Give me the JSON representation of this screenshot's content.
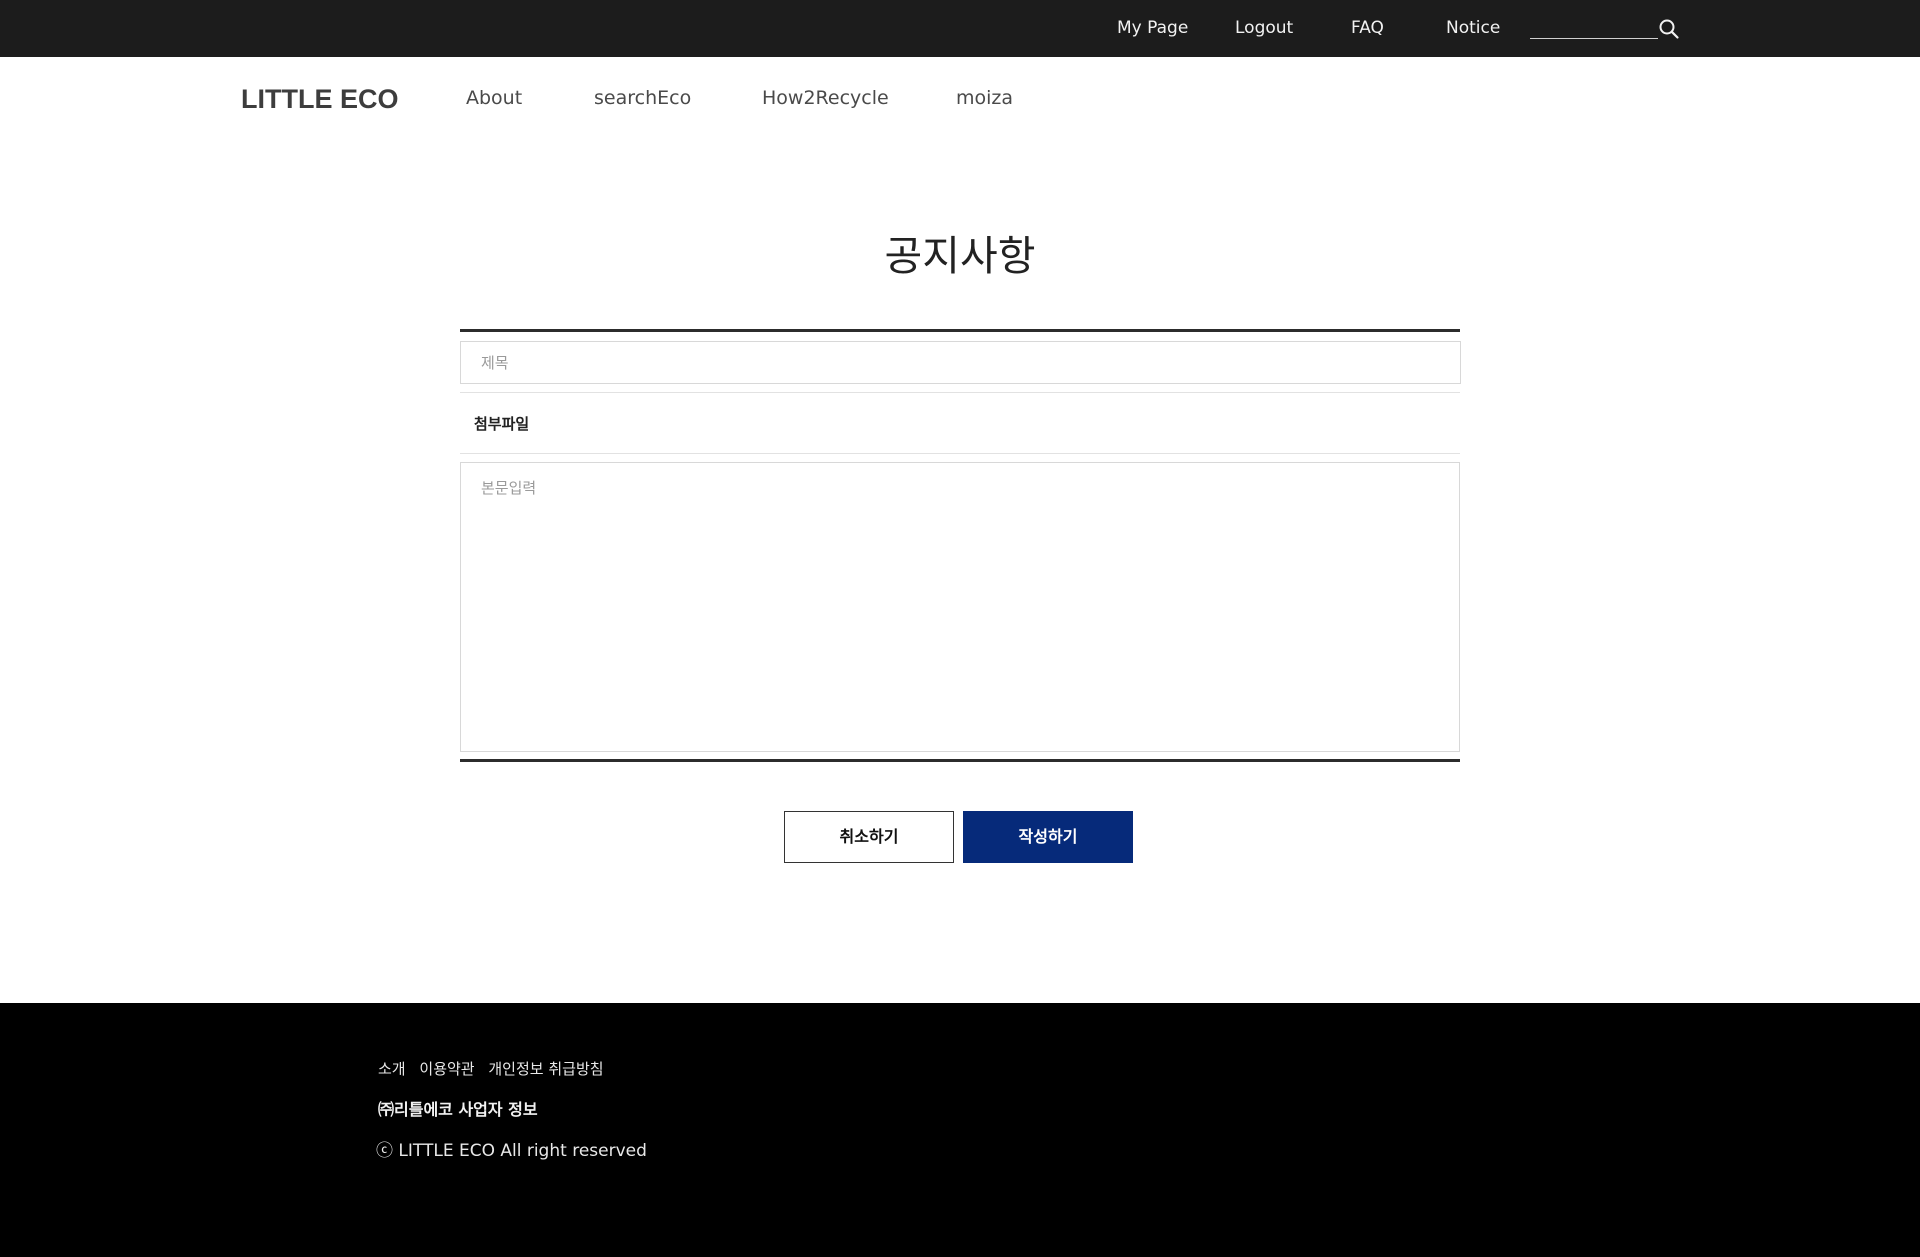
{
  "topbar": {
    "links": [
      "My Page",
      "Logout",
      "FAQ",
      "Notice"
    ],
    "search_value": ""
  },
  "header": {
    "logo": "LITTLE ECO",
    "nav": [
      "About",
      "searchEco",
      "How2Recycle",
      "moiza"
    ]
  },
  "page": {
    "title": "공지사항"
  },
  "form": {
    "title_placeholder": "제목",
    "title_value": "",
    "attach_label": "첨부파일",
    "body_placeholder": "본문입력",
    "body_value": "",
    "cancel_label": "취소하기",
    "submit_label": "작성하기"
  },
  "footer": {
    "links": [
      "소개",
      "이용약관",
      "개인정보 취급방침"
    ],
    "company": "㈜리틀에코 사업자 정보",
    "copyright": "ⓒ LITTLE ECO  All right reserved"
  },
  "colors": {
    "topbar_bg": "#1c1c1c",
    "submit_bg": "#062a7a",
    "footer_bg": "#000000"
  },
  "icons": {
    "search": "search-icon"
  }
}
